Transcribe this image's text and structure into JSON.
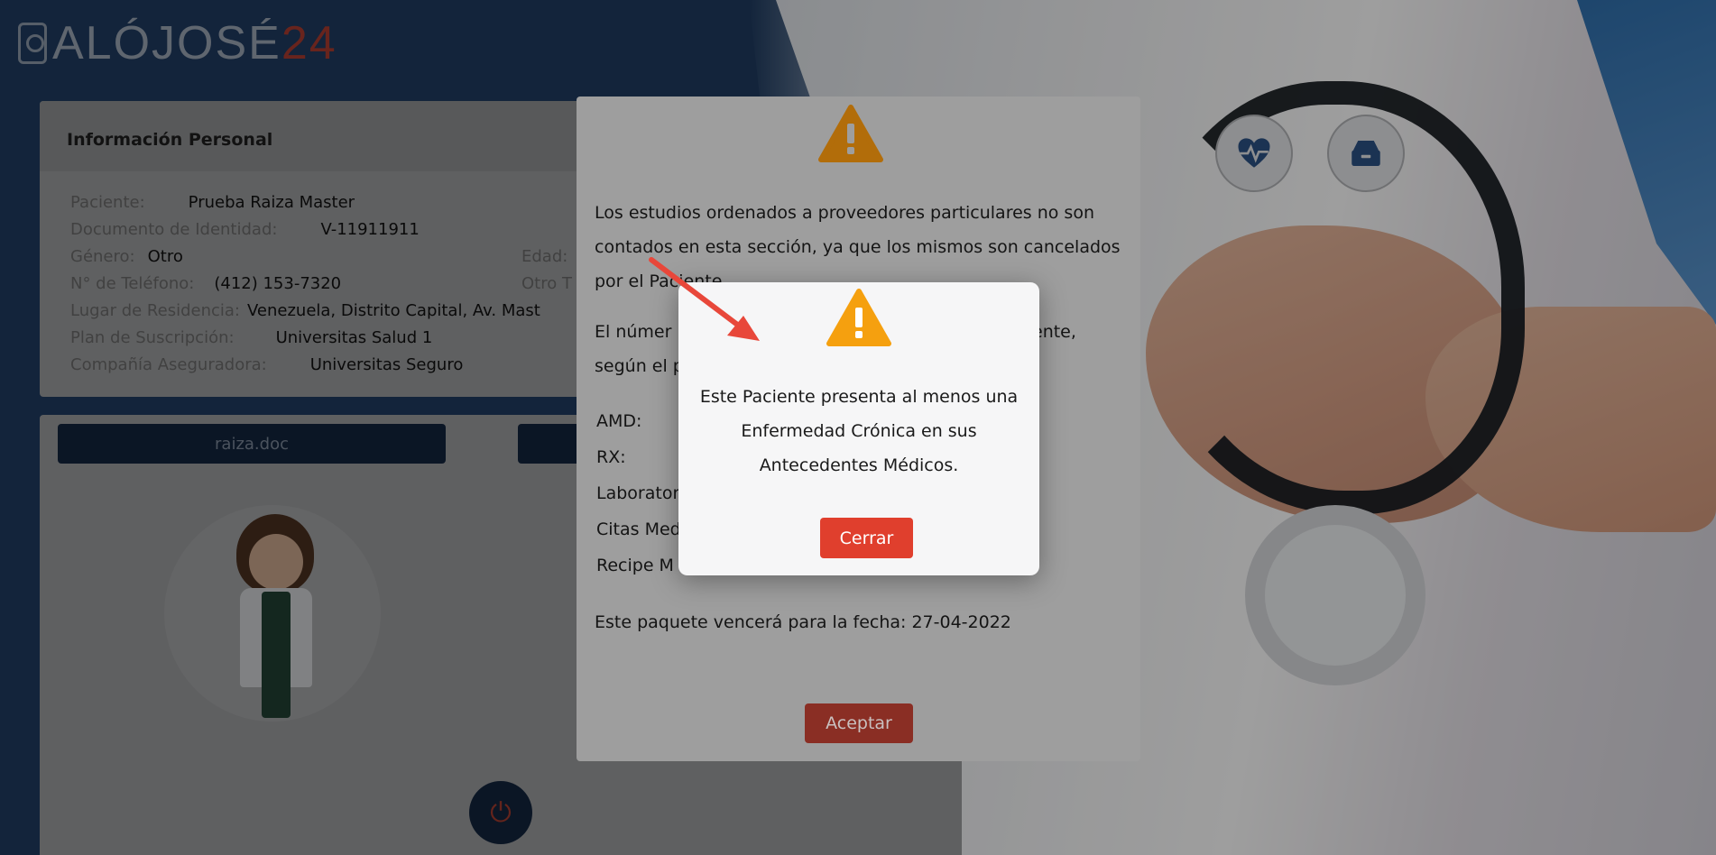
{
  "logo": {
    "text": "ALÓJOSÉ",
    "number": "24"
  },
  "info_card": {
    "title": "Información Personal",
    "rows": [
      {
        "label": "Paciente:",
        "value": "Prueba Raiza Master"
      },
      {
        "label": "Documento de Identidad:",
        "value": "V-11911911"
      },
      {
        "label": "Género:",
        "value": "Otro",
        "right_label": "Edad:"
      },
      {
        "label": "N° de Teléfono:",
        "value": "(412) 153-7320",
        "right_label": "Otro T"
      },
      {
        "label": "Lugar de Residencia:",
        "value": "Venezuela, Distrito Capital, Av. Mast"
      },
      {
        "label": "Plan de Suscripción:",
        "value": "Universitas Salud 1"
      },
      {
        "label": "Compañía Aseguradora:",
        "value": "Universitas Seguro"
      }
    ]
  },
  "profile_card": {
    "doc_button": "raiza.doc"
  },
  "header_icons": [
    "heartbeat-icon",
    "archive-icon"
  ],
  "outer_modal": {
    "icon": "warning-icon",
    "paragraph1": "Los estudios ordenados a proveedores particulares no son contados en esta sección, ya que los mismos son cancelados por el Paciente.",
    "paragraph2_start": "El númer",
    "paragraph2_end": "ente,",
    "paragraph2_line2": "según el p",
    "list": [
      "AMD:",
      "RX:",
      "Laborator",
      "Citas Med",
      "Recipe M"
    ],
    "expiry": "Este paquete vencerá para la fecha: 27-04-2022",
    "accept_label": "Aceptar"
  },
  "inner_modal": {
    "icon": "warning-icon",
    "message": "Este Paciente presenta al menos una Enfermedad Crónica en sus Antecedentes Médicos.",
    "close_label": "Cerrar"
  },
  "colors": {
    "warning": "#f5a00f",
    "close_button": "#e03f2d",
    "navy": "#1f3b60"
  }
}
